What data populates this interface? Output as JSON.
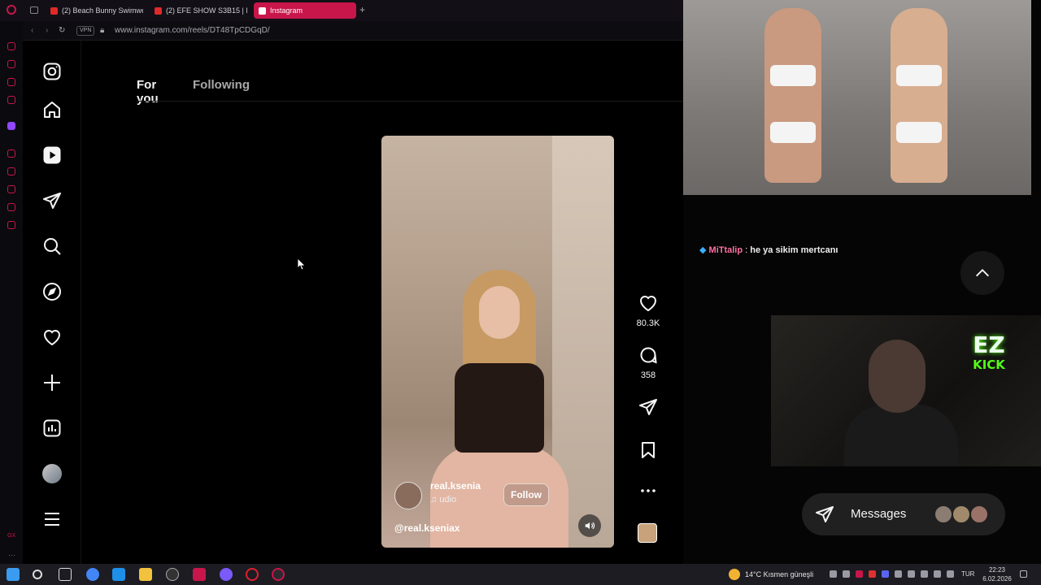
{
  "browser": {
    "tabs": [
      {
        "label": "(2) Beach Bunny Swimwe",
        "favicon_color": "#e02a2a",
        "active": false
      },
      {
        "label": "(2) EFE SHOW S3B15 | M",
        "favicon_color": "#e02a2a",
        "active": false
      },
      {
        "label": "Instagram",
        "favicon_color": "#e1306c",
        "active": true
      }
    ],
    "vpn_label": "VPN",
    "url": "www.instagram.com/reels/DT48TpCDGqD/"
  },
  "instagram": {
    "feed_tabs": {
      "for_you": "For you",
      "following": "Following"
    },
    "nav_icons": [
      "instagram-logo-icon",
      "home-icon",
      "reels-icon",
      "messages-icon",
      "search-icon",
      "explore-icon",
      "notifications-icon",
      "create-icon",
      "dashboard-icon",
      "profile-avatar",
      "more-menu-icon"
    ],
    "reel": {
      "username": "real.ksenia",
      "audio_text": "udio",
      "follow_label": "Follow",
      "caption": "@real.kseniax"
    },
    "actions": {
      "likes": "80.3K",
      "comments": "358"
    }
  },
  "stream": {
    "chat": {
      "user": "MiTtalip",
      "separator": " : ",
      "message": "he ya sikim mertcanı"
    },
    "kick_logo": {
      "top": "EZ",
      "bottom": "KICK"
    },
    "messages_label": "Messages"
  },
  "taskbar": {
    "weather": "14°C  Kısmen güneşli",
    "language": "TUR",
    "time": "22:23",
    "date": "6.02.2026"
  },
  "colors": {
    "accent": "#c8164a",
    "kick_green": "#53fc18",
    "chat_user": "#ff6fa0"
  }
}
